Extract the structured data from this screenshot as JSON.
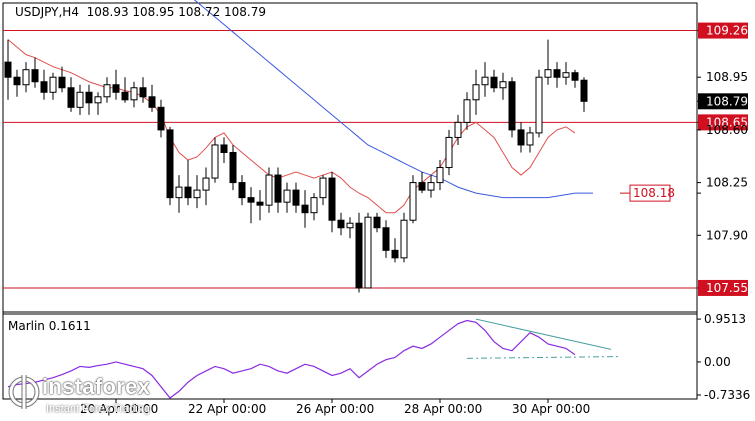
{
  "header": {
    "symbol": "USDJPY,H4",
    "ohlc": "108.93 108.95 108.72 108.79",
    "indicator": "Marlin 0.1611"
  },
  "watermark": {
    "brand": "instaforex",
    "tagline": "Instant Forex Trading"
  },
  "colors": {
    "candle": "#000000",
    "ma_fast": "#e05050",
    "ma_slow": "#3a5ae0",
    "level": "#d01020",
    "oscillator": "#8a2be2",
    "trendline": "#4aa0a0",
    "grid": "#d8d8d8"
  },
  "chart_data": [
    {
      "type": "candlestick",
      "title": "USDJPY,H4",
      "ylim": [
        107.55,
        109.35
      ],
      "y_ticks": [
        "109.26",
        "108.95",
        "108.79",
        "108.65",
        "108.60",
        "108.25",
        "108.18",
        "107.90",
        "107.55"
      ],
      "y_tick_values": [
        109.26,
        108.95,
        108.79,
        108.65,
        108.6,
        108.25,
        108.18,
        107.9,
        107.55
      ],
      "y_tick_styles": [
        "red-box",
        "plain",
        "black-box",
        "red-box",
        "plain",
        "plain",
        "red-outline",
        "plain",
        "red-box"
      ],
      "x_ticks": [
        "20 Apr 00:00",
        "22 Apr 00:00",
        "26 Apr 00:00",
        "28 Apr 00:00",
        "30 Apr 00:00"
      ],
      "x_tick_index": [
        12,
        24,
        36,
        48,
        60
      ],
      "horizontal_levels": [
        109.26,
        108.65,
        107.55
      ],
      "candles": [
        [
          109.05,
          109.2,
          108.8,
          108.95
        ],
        [
          108.95,
          109.0,
          108.82,
          108.9
        ],
        [
          108.9,
          109.05,
          108.85,
          109.0
        ],
        [
          109.0,
          109.08,
          108.88,
          108.92
        ],
        [
          108.92,
          109.0,
          108.8,
          108.85
        ],
        [
          108.85,
          108.98,
          108.8,
          108.95
        ],
        [
          108.95,
          109.02,
          108.85,
          108.88
        ],
        [
          108.88,
          108.95,
          108.72,
          108.75
        ],
        [
          108.75,
          108.9,
          108.7,
          108.85
        ],
        [
          108.85,
          108.9,
          108.7,
          108.78
        ],
        [
          108.78,
          108.85,
          108.7,
          108.82
        ],
        [
          108.82,
          108.95,
          108.78,
          108.9
        ],
        [
          108.9,
          109.0,
          108.8,
          108.85
        ],
        [
          108.85,
          108.95,
          108.78,
          108.8
        ],
        [
          108.8,
          108.92,
          108.75,
          108.88
        ],
        [
          108.88,
          108.95,
          108.78,
          108.82
        ],
        [
          108.82,
          108.9,
          108.72,
          108.75
        ],
        [
          108.75,
          108.8,
          108.55,
          108.6
        ],
        [
          108.6,
          108.62,
          108.1,
          108.15
        ],
        [
          108.15,
          108.3,
          108.05,
          108.22
        ],
        [
          108.22,
          108.4,
          108.1,
          108.15
        ],
        [
          108.15,
          108.3,
          108.08,
          108.2
        ],
        [
          108.2,
          108.35,
          108.1,
          108.28
        ],
        [
          108.28,
          108.55,
          108.25,
          108.5
        ],
        [
          108.5,
          108.55,
          108.38,
          108.45
        ],
        [
          108.45,
          108.5,
          108.2,
          108.25
        ],
        [
          108.25,
          108.3,
          108.1,
          108.15
        ],
        [
          108.15,
          108.22,
          107.98,
          108.12
        ],
        [
          108.12,
          108.2,
          108.0,
          108.1
        ],
        [
          108.1,
          108.35,
          108.05,
          108.3
        ],
        [
          108.3,
          108.35,
          108.05,
          108.12
        ],
        [
          108.12,
          108.25,
          108.05,
          108.2
        ],
        [
          108.2,
          108.25,
          108.05,
          108.1
        ],
        [
          108.1,
          108.2,
          107.95,
          108.05
        ],
        [
          108.05,
          108.18,
          108.0,
          108.15
        ],
        [
          108.15,
          108.3,
          108.1,
          108.28
        ],
        [
          108.28,
          108.32,
          107.92,
          108.0
        ],
        [
          108.0,
          108.05,
          107.9,
          107.95
        ],
        [
          107.95,
          108.02,
          107.88,
          107.98
        ],
        [
          107.98,
          108.05,
          107.52,
          107.55
        ],
        [
          107.55,
          108.05,
          107.55,
          108.02
        ],
        [
          108.02,
          108.05,
          107.92,
          107.95
        ],
        [
          107.95,
          108.0,
          107.75,
          107.8
        ],
        [
          107.8,
          107.88,
          107.72,
          107.75
        ],
        [
          107.75,
          108.05,
          107.72,
          108.0
        ],
        [
          108.0,
          108.3,
          107.98,
          108.25
        ],
        [
          108.25,
          108.32,
          108.18,
          108.2
        ],
        [
          108.2,
          108.3,
          108.15,
          108.25
        ],
        [
          108.25,
          108.4,
          108.2,
          108.35
        ],
        [
          108.35,
          108.6,
          108.3,
          108.55
        ],
        [
          108.55,
          108.7,
          108.5,
          108.65
        ],
        [
          108.65,
          108.85,
          108.6,
          108.8
        ],
        [
          108.8,
          109.0,
          108.7,
          108.9
        ],
        [
          108.9,
          109.05,
          108.82,
          108.95
        ],
        [
          108.95,
          109.0,
          108.85,
          108.88
        ],
        [
          108.88,
          108.98,
          108.8,
          108.92
        ],
        [
          108.92,
          108.95,
          108.55,
          108.6
        ],
        [
          108.6,
          108.65,
          108.45,
          108.5
        ],
        [
          108.5,
          108.62,
          108.45,
          108.58
        ],
        [
          108.58,
          109.0,
          108.55,
          108.95
        ],
        [
          108.95,
          109.2,
          108.9,
          109.0
        ],
        [
          109.0,
          109.05,
          108.88,
          108.95
        ],
        [
          108.95,
          109.05,
          108.9,
          108.98
        ],
        [
          108.98,
          109.0,
          108.88,
          108.93
        ],
        [
          108.93,
          108.95,
          108.72,
          108.79
        ]
      ],
      "series": [
        {
          "name": "",
          "values": [
            109.2,
            109.15,
            109.1,
            109.08,
            109.05,
            109.02,
            109.0,
            108.98,
            108.95,
            108.92,
            108.9,
            108.88,
            108.88,
            108.86,
            108.85,
            108.82,
            108.78,
            108.7,
            108.55,
            108.45,
            108.4,
            108.42,
            108.48,
            108.55,
            108.58,
            108.5,
            108.45,
            108.4,
            108.35,
            108.3,
            108.28,
            108.3,
            108.32,
            108.3,
            108.28,
            108.3,
            108.32,
            108.28,
            108.22,
            108.18,
            108.15,
            108.1,
            108.05,
            108.05,
            108.1,
            108.2,
            108.25,
            108.3,
            108.35,
            108.45,
            108.55,
            108.62,
            108.65,
            108.6,
            108.55,
            108.45,
            108.35,
            108.3,
            108.35,
            108.45,
            108.55,
            108.6,
            108.62,
            108.58
          ]
        },
        {
          "name": "",
          "values": [
            109.6,
            109.55,
            109.5,
            109.45,
            109.4,
            109.35,
            109.3,
            109.25,
            109.2,
            109.15,
            109.1,
            109.05,
            109.0,
            108.95,
            108.9,
            108.85,
            108.8,
            108.75,
            108.7,
            108.65,
            108.6,
            108.55,
            108.5,
            108.47,
            108.44,
            108.41,
            108.38,
            108.35,
            108.32,
            108.3,
            108.28,
            108.25,
            108.22,
            108.2,
            108.18,
            108.17,
            108.16,
            108.15,
            108.15,
            108.15,
            108.15,
            108.15,
            108.15,
            108.16,
            108.17,
            108.18,
            108.18,
            108.18
          ]
        }
      ]
    },
    {
      "type": "line",
      "title": "Marlin 0.1611",
      "ylim": [
        -0.7336,
        0.9513
      ],
      "y_ticks": [
        "0.9513",
        "0.00",
        "-0.7336"
      ],
      "y_tick_values": [
        0.9513,
        0.0,
        -0.7336
      ],
      "x_ticks": [
        "20 Apr 00:00",
        "22 Apr 00:00",
        "26 Apr 00:00",
        "28 Apr 00:00",
        "30 Apr 00:00"
      ],
      "series": [
        {
          "name": "Marlin",
          "values": [
            -0.55,
            -0.5,
            -0.48,
            -0.45,
            -0.4,
            -0.35,
            -0.28,
            -0.2,
            -0.1,
            -0.12,
            -0.08,
            -0.05,
            0.0,
            -0.05,
            -0.1,
            -0.15,
            -0.3,
            -0.55,
            -0.8,
            -0.65,
            -0.45,
            -0.3,
            -0.2,
            -0.1,
            -0.15,
            -0.25,
            -0.2,
            -0.15,
            -0.05,
            -0.1,
            -0.2,
            -0.25,
            -0.15,
            -0.05,
            -0.1,
            -0.2,
            -0.3,
            -0.25,
            -0.15,
            -0.35,
            -0.2,
            -0.05,
            0.05,
            0.1,
            0.25,
            0.35,
            0.3,
            0.4,
            0.55,
            0.7,
            0.85,
            0.92,
            0.88,
            0.7,
            0.45,
            0.3,
            0.25,
            0.45,
            0.65,
            0.55,
            0.4,
            0.35,
            0.3,
            0.16
          ]
        }
      ]
    }
  ]
}
